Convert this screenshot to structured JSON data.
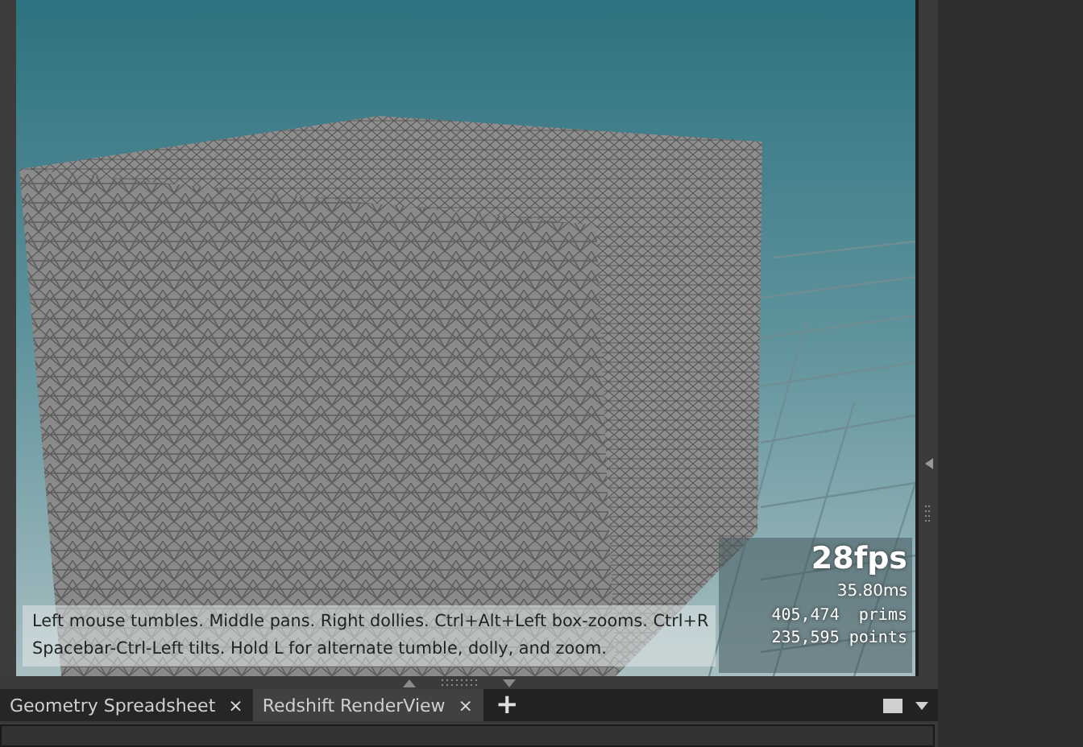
{
  "viewport": {
    "hint_lines": [
      "Left mouse tumbles. Middle pans. Right dollies. Ctrl+Alt+Left box-zooms. Ctrl+R",
      "Spacebar-Ctrl-Left tilts. Hold L for alternate tumble, dolly, and zoom."
    ],
    "stats": {
      "fps": "28fps",
      "time": "35.80ms",
      "lines": [
        "405,474  prims",
        "235,595 points"
      ]
    }
  },
  "tabs": [
    {
      "label": "Geometry Spreadsheet",
      "selected": false,
      "close": "×"
    },
    {
      "label": "Redshift RenderView",
      "selected": true,
      "close": "×"
    }
  ],
  "add_tab": "+"
}
